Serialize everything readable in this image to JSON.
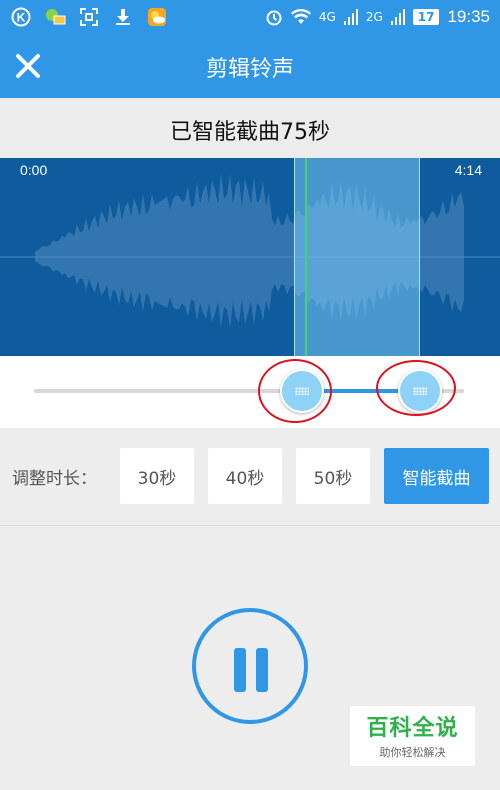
{
  "status_bar": {
    "signal_1": "4G",
    "signal_2": "2G",
    "battery": "17",
    "time": "19:35",
    "icons": [
      "k-app-icon",
      "wechat-mail-icon",
      "scan-icon",
      "download-icon",
      "weather-icon",
      "alarm-icon",
      "wifi-icon",
      "signal-icon"
    ]
  },
  "header": {
    "title": "剪辑铃声",
    "close_icon": "close-icon"
  },
  "subtitle": "已智能截曲75秒",
  "waveform": {
    "start_time": "0:00",
    "end_time": "4:14"
  },
  "range_slider": {
    "start_fraction": 0.63,
    "end_fraction": 0.91
  },
  "duration": {
    "label": "调整时长：",
    "options": [
      "30秒",
      "40秒",
      "50秒",
      "智能截曲"
    ],
    "selected": "智能截曲"
  },
  "player": {
    "state_icon": "pause-icon"
  },
  "watermark": {
    "main": "百科全说",
    "sub": "助你轻松解决"
  },
  "colors": {
    "accent": "#2f97e6",
    "waveform_bg": "#0e5b9d",
    "selection": "#78c8f5",
    "playhead": "#48d36a",
    "annotation": "#d9141e"
  }
}
